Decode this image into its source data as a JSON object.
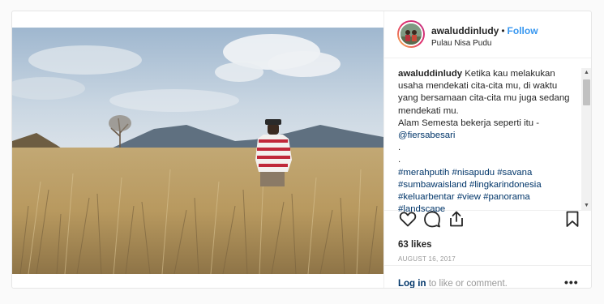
{
  "post": {
    "username": "awaluddinludy",
    "separator": "•",
    "follow_label": "Follow",
    "location": "Pulau Nisa Pudu",
    "caption_lines": [
      "Ketika kau melakukan",
      "usaha mendekati cita-cita mu, di waktu",
      "yang bersamaan cita-cita mu juga sedang",
      "mendekati mu.",
      "Alam Semesta bekerja seperti itu -",
      "@fiersabesari",
      ".",
      ".",
      "#merahputih #nisapudu #savana",
      "#sumbawaisland #lingkarindonesia",
      "#keluarbentar #view #panorama",
      "#landscape"
    ],
    "likes": "63 likes",
    "date": "AUGUST 16, 2017",
    "login_link": "Log in",
    "login_rest": " to like or comment.",
    "more_label": "•••"
  },
  "icons": {
    "like": "heart-icon",
    "comment": "comment-icon",
    "share": "share-icon",
    "save": "bookmark-icon",
    "scroll_up": "scroll-up-arrow-icon",
    "scroll_down": "scroll-down-arrow-icon"
  },
  "colors": {
    "follow": "#3897f0",
    "link": "#003569",
    "muted": "#999999",
    "border": "#efefef"
  }
}
